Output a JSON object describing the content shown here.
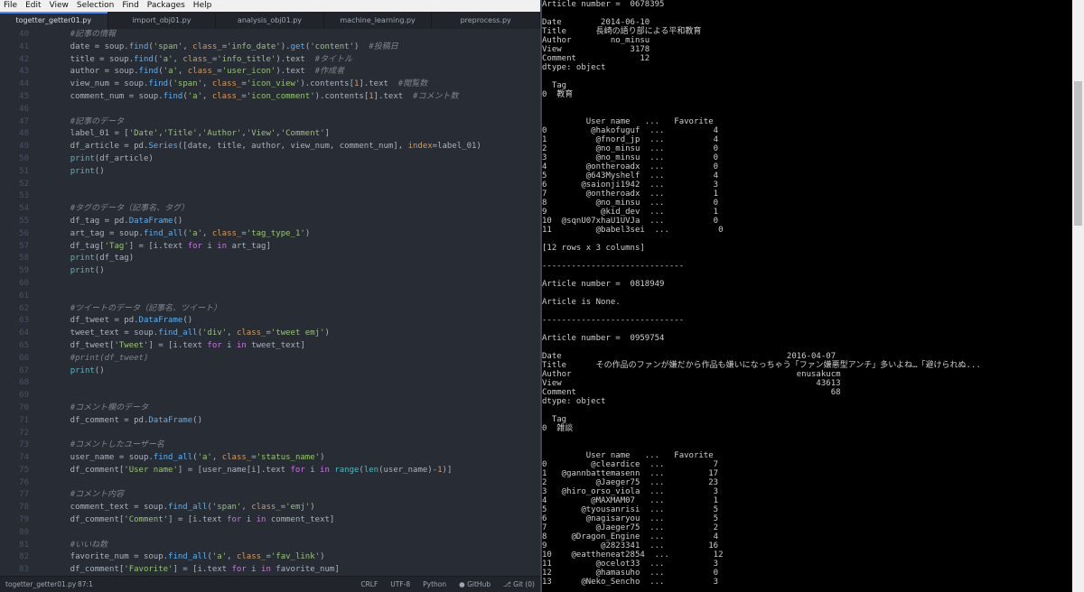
{
  "menu": [
    "File",
    "Edit",
    "View",
    "Selection",
    "Find",
    "Packages",
    "Help"
  ],
  "tabs": [
    "togetter_getter01.py",
    "import_obj01.py",
    "analysis_obj01.py",
    "machine_learning.py",
    "preprocess.py"
  ],
  "code_lines": [
    {
      "n": "40",
      "t": "    #記事の情報"
    },
    {
      "n": "41",
      "t": "    date = soup.find('span', class_='info_date').get('content')  #投稿日"
    },
    {
      "n": "42",
      "t": "    title = soup.find('a', class_='info_title').text  #タイトル"
    },
    {
      "n": "43",
      "t": "    author = soup.find('a', class_='user_icon').text  #作成者"
    },
    {
      "n": "44",
      "t": "    view_num = soup.find('span', class_='icon_view').contents[1].text  #閲覧数"
    },
    {
      "n": "45",
      "t": "    comment_num = soup.find('a', class_='icon_comment').contents[1].text  #コメント数"
    },
    {
      "n": "46",
      "t": ""
    },
    {
      "n": "47",
      "t": "    #記事のデータ"
    },
    {
      "n": "48",
      "t": "    label_01 = ['Date','Title','Author','View','Comment']"
    },
    {
      "n": "49",
      "t": "    df_article = pd.Series([date, title, author, view_num, comment_num], index=label_01)"
    },
    {
      "n": "50",
      "t": "    print(df_article)"
    },
    {
      "n": "51",
      "t": "    print()"
    },
    {
      "n": "52",
      "t": ""
    },
    {
      "n": "53",
      "t": ""
    },
    {
      "n": "54",
      "t": "    #タグのデータ（記事名、タグ）"
    },
    {
      "n": "55",
      "t": "    df_tag = pd.DataFrame()"
    },
    {
      "n": "56",
      "t": "    art_tag = soup.find_all('a', class_='tag_type_1')"
    },
    {
      "n": "57",
      "t": "    df_tag['Tag'] = [i.text for i in art_tag]"
    },
    {
      "n": "58",
      "t": "    print(df_tag)"
    },
    {
      "n": "59",
      "t": "    print()"
    },
    {
      "n": "60",
      "t": ""
    },
    {
      "n": "61",
      "t": ""
    },
    {
      "n": "62",
      "t": "    #ツイートのデータ（記事名、ツイート）"
    },
    {
      "n": "63",
      "t": "    df_tweet = pd.DataFrame()"
    },
    {
      "n": "64",
      "t": "    tweet_text = soup.find_all('div', class_='tweet emj')"
    },
    {
      "n": "65",
      "t": "    df_tweet['Tweet'] = [i.text for i in tweet_text]"
    },
    {
      "n": "66",
      "t": "    #print(df_tweet)"
    },
    {
      "n": "67",
      "t": "    print()"
    },
    {
      "n": "68",
      "t": ""
    },
    {
      "n": "69",
      "t": ""
    },
    {
      "n": "70",
      "t": "    #コメント欄のデータ"
    },
    {
      "n": "71",
      "t": "    df_comment = pd.DataFrame()"
    },
    {
      "n": "72",
      "t": ""
    },
    {
      "n": "73",
      "t": "    #コメントしたユーザー名"
    },
    {
      "n": "74",
      "t": "    user_name = soup.find_all('a', class_='status_name')"
    },
    {
      "n": "75",
      "t": "    df_comment['User name'] = [user_name[i].text for i in range(len(user_name)-1)]"
    },
    {
      "n": "76",
      "t": ""
    },
    {
      "n": "77",
      "t": "    #コメント内容"
    },
    {
      "n": "78",
      "t": "    comment_text = soup.find_all('span', class_='emj')"
    },
    {
      "n": "79",
      "t": "    df_comment['Comment'] = [i.text for i in comment_text]"
    },
    {
      "n": "80",
      "t": ""
    },
    {
      "n": "81",
      "t": "    #いいね数"
    },
    {
      "n": "82",
      "t": "    favorite_num = soup.find_all('a', class_='fav_link')"
    },
    {
      "n": "83",
      "t": "    df_comment['Favorite'] = [i.text for i in favorite_num]"
    }
  ],
  "status": {
    "file": "togetter_getter01.py",
    "cursor": "87:1",
    "right": [
      "CRLF",
      "UTF-8",
      "Python",
      "GitHub",
      "Git (0)"
    ]
  },
  "terminal_lines": [
    "Article number =  0678395",
    "",
    "Date        2014-06-10",
    "Title      長崎の語り部による平和教育",
    "Author        no_minsu",
    "View              3178",
    "Comment             12",
    "dtype: object",
    "",
    "  Tag",
    "0  教育",
    "",
    "",
    "         User name   ...   Favorite",
    "0         @hakofuguf  ...          4",
    "1          @fnord_jp  ...          4",
    "2          @no_minsu  ...          0",
    "3          @no_minsu  ...          0",
    "4        @ontheroadx  ...          0",
    "5        @643Myshelf  ...          4",
    "6       @saionji1942  ...          3",
    "7        @ontheroadx  ...          1",
    "8          @no_minsu  ...          0",
    "9           @kid_dev  ...          1",
    "10  @sqnU07xhaU1UVJa  ...          0",
    "11         @babel3sei  ...          0",
    "",
    "[12 rows x 3 columns]",
    "",
    "-----------------------------",
    "",
    "Article number =  0818949",
    "",
    "Article is None.",
    "",
    "-----------------------------",
    "",
    "Article number =  0959754",
    "",
    "Date                                              2016-04-07",
    "Title      その作品のファンが嫌だから作品も嫌いになっちゃう「ファン嫌悪型アンチ」多いよね…「避けられぬ...",
    "Author                                              enusakucm",
    "View                                                    43613",
    "Comment                                                    68",
    "dtype: object",
    "",
    "  Tag",
    "0  雑談",
    "",
    "",
    "         User name   ...   Favorite",
    "0         @cleardice  ...          7",
    "1   @gannbattemasenn  ...         17",
    "2          @Jaeger75  ...         23",
    "3   @hiro_orso_viola  ...          3",
    "4         @MAXMAM07   ...          1",
    "5       @tyousanrisi  ...          5",
    "6        @nagisaryou  ...          5",
    "7          @Jaeger75  ...          2",
    "8     @Dragon_Engine  ...          4",
    "9           @2823341  ...         16",
    "10    @eattheneat2854  ...         12",
    "11         @ocelot33  ...          3",
    "12         @hamasuho  ...          0",
    "13      @Neko_Sencho  ...          3"
  ],
  "colors": {
    "keyword": "#c678dd",
    "string": "#98c379",
    "comment": "#7f848e",
    "func": "#61afef",
    "class": "#56b6c2",
    "param": "#d19a66",
    "number": "#d19a66"
  }
}
